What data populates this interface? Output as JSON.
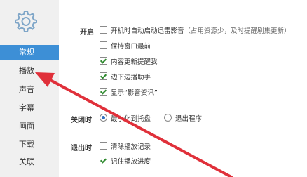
{
  "sidebar": {
    "items": [
      {
        "label": "常规",
        "active": true
      },
      {
        "label": "播放",
        "active": false
      },
      {
        "label": "声音",
        "active": false
      },
      {
        "label": "字幕",
        "active": false
      },
      {
        "label": "画面",
        "active": false
      },
      {
        "label": "下载",
        "active": false
      },
      {
        "label": "关联",
        "active": false
      }
    ]
  },
  "startup": {
    "label": "开启",
    "options": [
      {
        "text": "开机时自动启动迅雷影音",
        "hint": "（占用资源少，及时提醒剧集更新）",
        "checked": false
      },
      {
        "text": "保持窗口最前",
        "checked": false
      },
      {
        "text": "内容更新提醒我",
        "checked": true
      },
      {
        "text": "边下边播助手",
        "checked": true
      },
      {
        "text": "显示“影音资讯”",
        "checked": true
      }
    ]
  },
  "on_close": {
    "label": "关闭时",
    "options": [
      {
        "text": "最小化到托盘",
        "selected": true
      },
      {
        "text": "退出程序",
        "selected": false
      }
    ]
  },
  "on_exit": {
    "label": "退出时",
    "options": [
      {
        "text": "清除播放记录",
        "checked": false
      },
      {
        "text": "记住播放进度",
        "checked": true
      }
    ]
  },
  "colors": {
    "accent": "#3d8fd6",
    "annotation_arrow": "#e0303a"
  }
}
